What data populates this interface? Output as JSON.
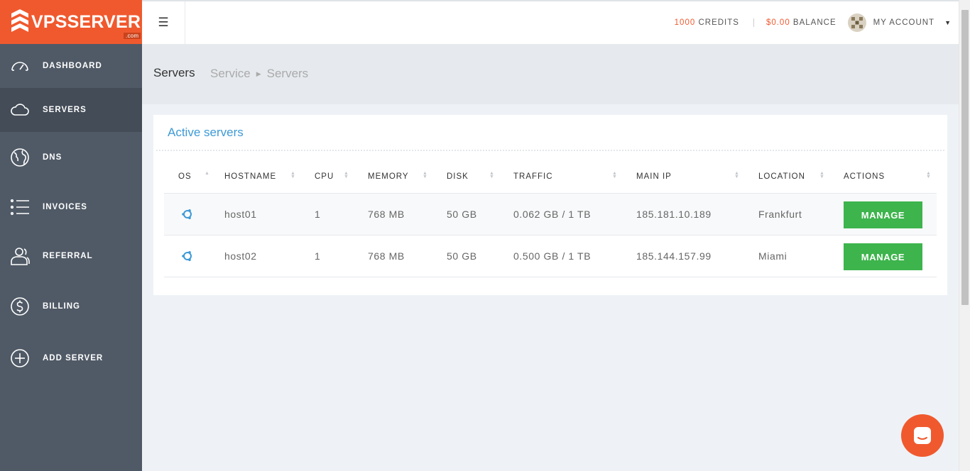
{
  "brand": {
    "name": "VPSSERVER",
    "suffix": ".com"
  },
  "sidebar": {
    "items": [
      {
        "label": "DASHBOARD",
        "icon": "speedometer-icon"
      },
      {
        "label": "SERVERS",
        "icon": "cloud-icon",
        "active": true
      },
      {
        "label": "DNS",
        "icon": "globe-icon"
      },
      {
        "label": "INVOICES",
        "icon": "list-icon"
      },
      {
        "label": "REFERRAL",
        "icon": "users-icon"
      },
      {
        "label": "BILLING",
        "icon": "dollar-icon"
      },
      {
        "label": "ADD SERVER",
        "icon": "plus-circle-icon"
      }
    ]
  },
  "topbar": {
    "credits_value": "1000",
    "credits_label": "CREDITS",
    "balance_value": "$0.00",
    "balance_label": "BALANCE",
    "account_label": "MY ACCOUNT"
  },
  "page": {
    "title": "Servers",
    "breadcrumb": [
      "Service",
      "Servers"
    ]
  },
  "card": {
    "title": "Active servers",
    "columns": [
      "OS",
      "HOSTNAME",
      "CPU",
      "MEMORY",
      "DISK",
      "TRAFFIC",
      "MAIN IP",
      "LOCATION",
      "ACTIONS"
    ],
    "rows": [
      {
        "os": "ubuntu-icon",
        "hostname": "host01",
        "cpu": "1",
        "memory": "768 MB",
        "disk": "50 GB",
        "traffic": "0.062 GB / 1 TB",
        "ip": "185.181.10.189",
        "location": "Frankfurt",
        "action": "MANAGE"
      },
      {
        "os": "ubuntu-icon",
        "hostname": "host02",
        "cpu": "1",
        "memory": "768 MB",
        "disk": "50 GB",
        "traffic": "0.500 GB / 1 TB",
        "ip": "185.144.157.99",
        "location": "Miami",
        "action": "MANAGE"
      }
    ]
  },
  "colors": {
    "brand": "#f0592e",
    "sidebar": "#505a66",
    "accent_blue": "#3d9ad6",
    "button_green": "#3db44c"
  }
}
